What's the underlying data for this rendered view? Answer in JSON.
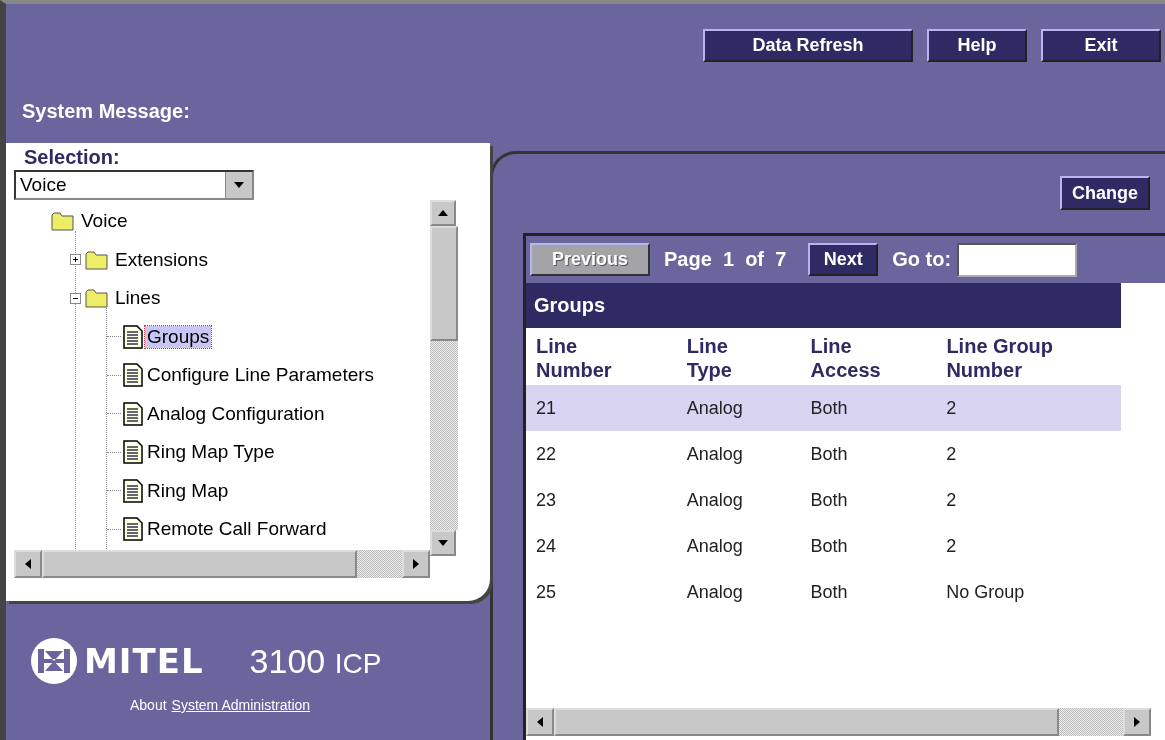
{
  "header": {
    "buttons": [
      "Data Refresh",
      "Help",
      "Exit"
    ],
    "system_message_label": "System Message:"
  },
  "selection": {
    "label": "Selection:",
    "value": "Voice"
  },
  "tree": [
    {
      "label": "Voice",
      "kind": "folder",
      "selected": false,
      "children": [
        {
          "label": "Extensions",
          "kind": "folder",
          "expanded": false,
          "selected": false
        },
        {
          "label": "Lines",
          "kind": "folder",
          "expanded": true,
          "selected": false,
          "children": [
            {
              "label": "Groups",
              "kind": "document",
              "selected": true
            },
            {
              "label": "Configure Line Parameters",
              "kind": "document",
              "selected": false
            },
            {
              "label": "Analog Configuration",
              "kind": "document",
              "selected": false
            },
            {
              "label": "Ring Map Type",
              "kind": "document",
              "selected": false
            },
            {
              "label": "Ring Map",
              "kind": "document",
              "selected": false
            },
            {
              "label": "Remote Call Forward",
              "kind": "document",
              "selected": false
            }
          ]
        }
      ]
    }
  ],
  "footer": {
    "brand": "MITEL",
    "product": "3100",
    "product_suffix": "ICP",
    "about": "About",
    "link": "System Administration"
  },
  "change_button": "Change",
  "pager": {
    "previous": {
      "label": "Previous",
      "disabled": true
    },
    "page_label": "Page",
    "page": "1",
    "of": "of",
    "total": "7",
    "next": {
      "label": "Next",
      "disabled": false
    },
    "goto_label": "Go to:"
  },
  "table": {
    "title": "Groups",
    "columns": [
      "Line Number",
      "Line Type",
      "Line Access",
      "Line Group Number"
    ],
    "rows": [
      {
        "cells": [
          "21",
          "Analog",
          "Both",
          "2"
        ],
        "selected": true
      },
      {
        "cells": [
          "22",
          "Analog",
          "Both",
          "2"
        ],
        "selected": false
      },
      {
        "cells": [
          "23",
          "Analog",
          "Both",
          "2"
        ],
        "selected": false
      },
      {
        "cells": [
          "24",
          "Analog",
          "Both",
          "2"
        ],
        "selected": false
      },
      {
        "cells": [
          "25",
          "Analog",
          "Both",
          "No Group"
        ],
        "selected": false
      }
    ]
  }
}
